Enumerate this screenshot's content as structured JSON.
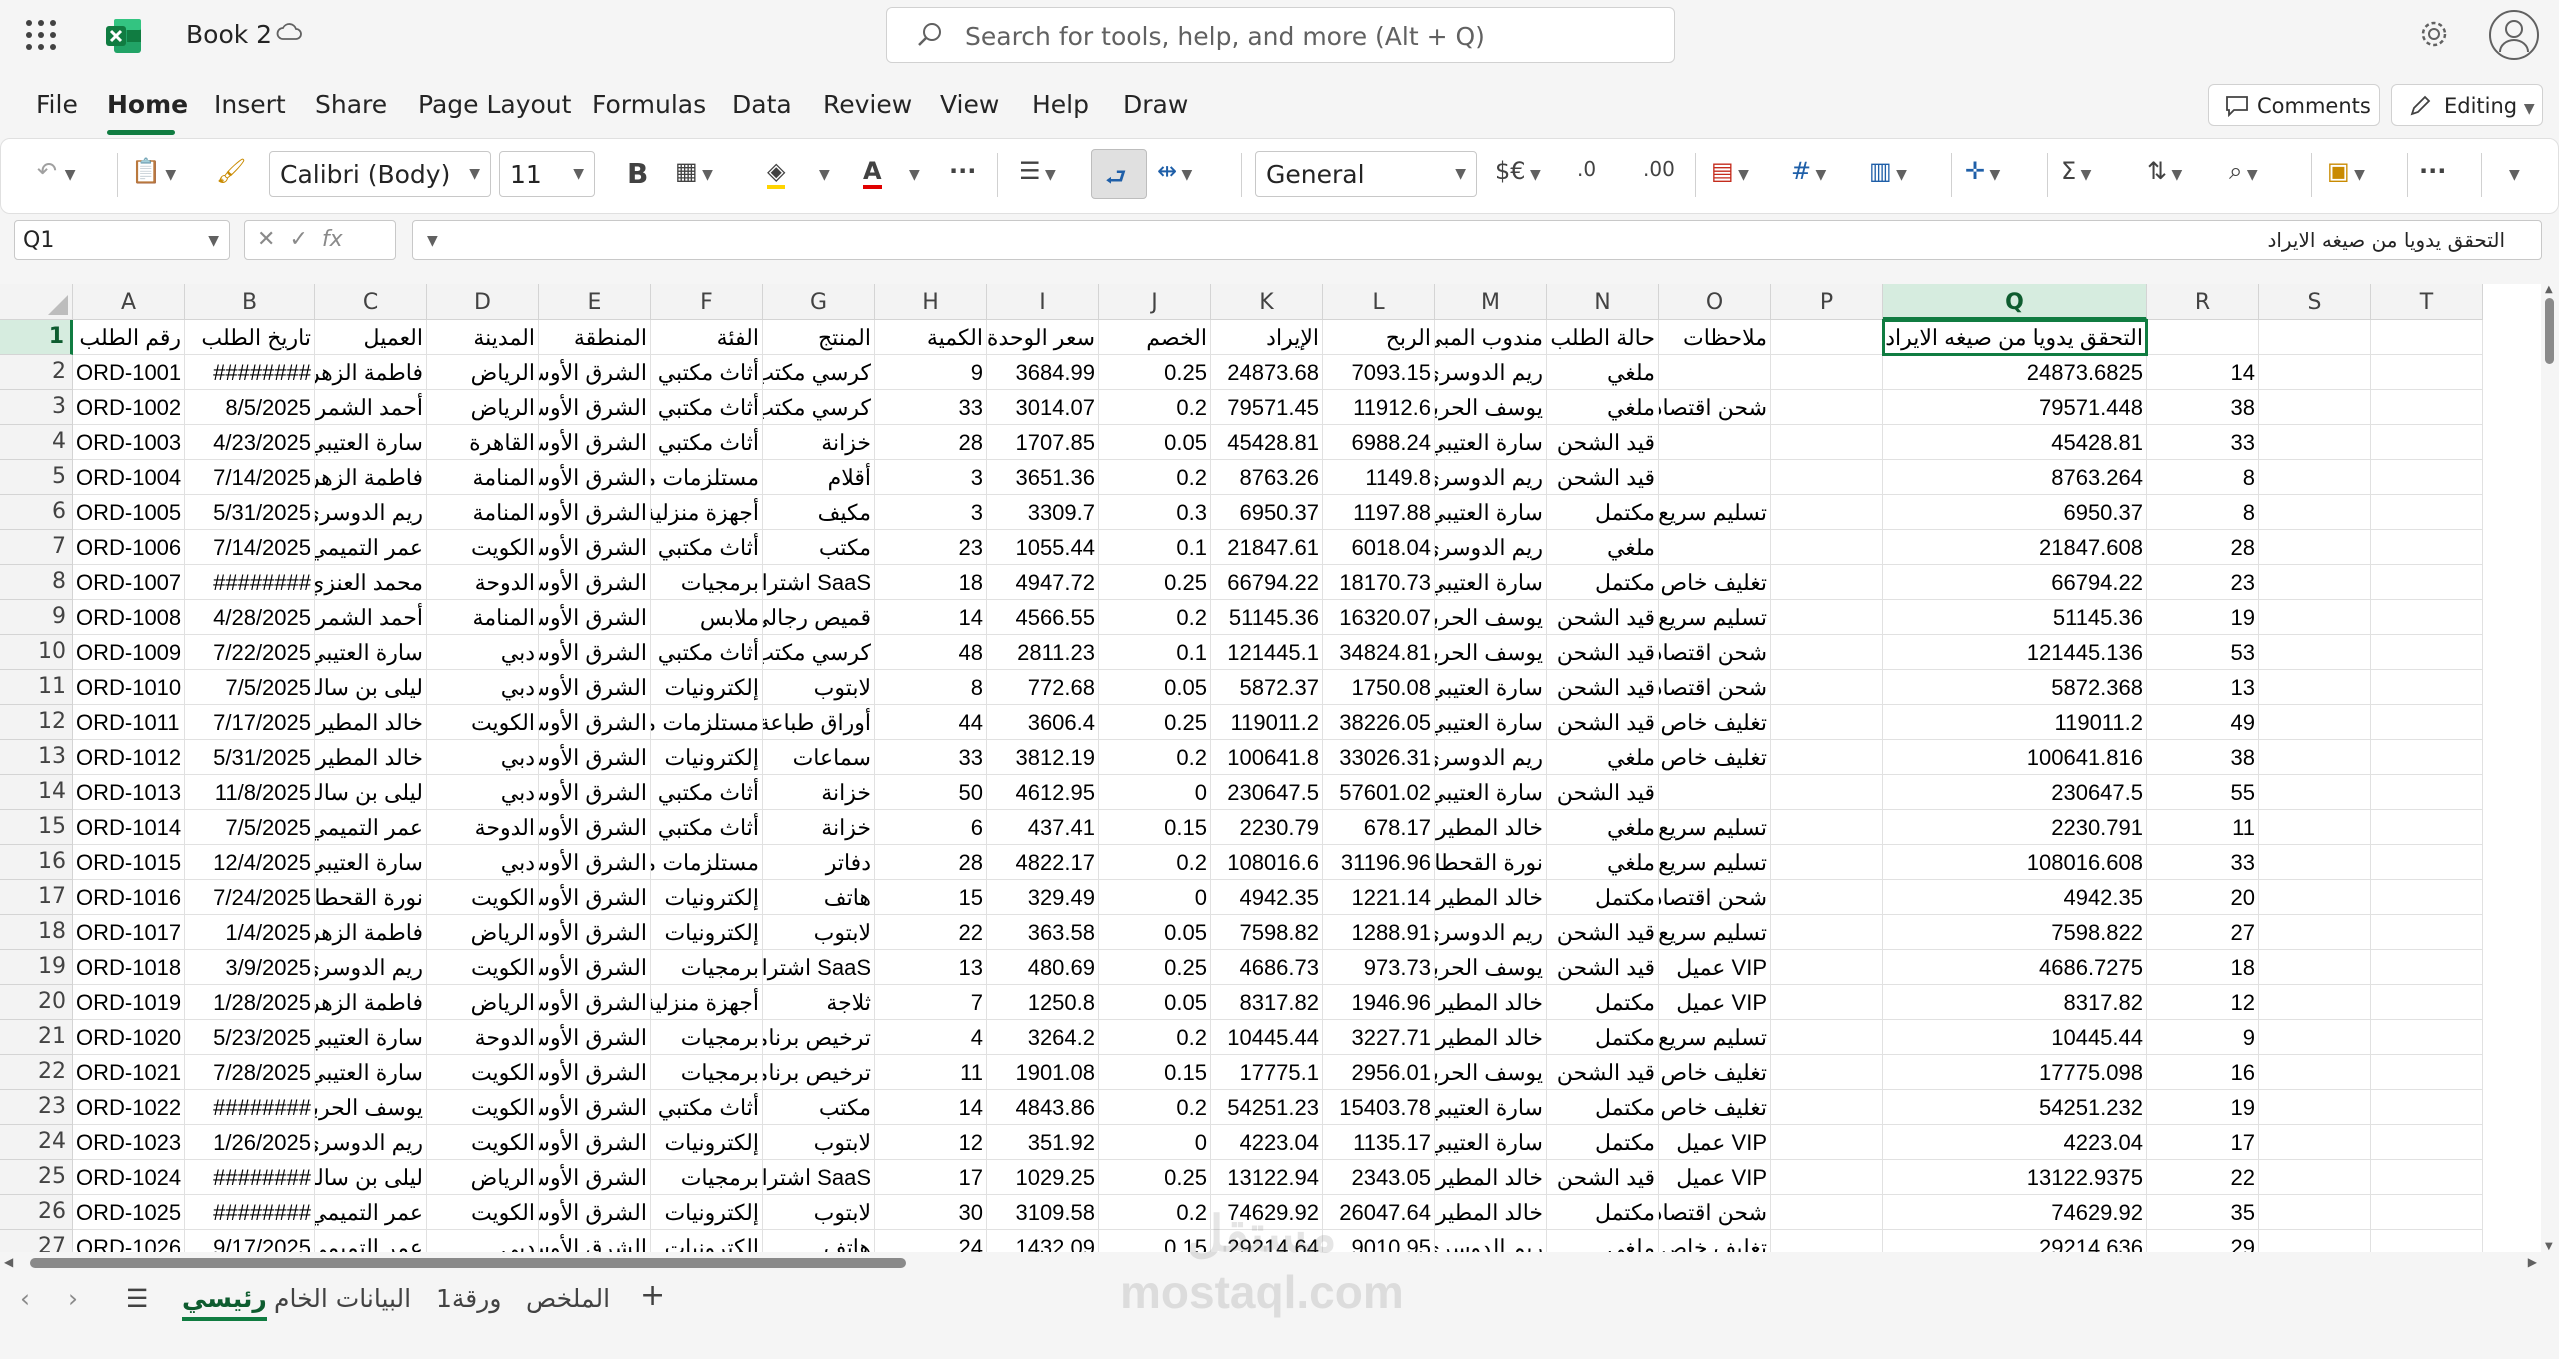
{
  "app": {
    "title": "Book 2",
    "search_placeholder": "Search for tools, help, and more (Alt + Q)"
  },
  "menu": {
    "items": [
      "File",
      "Home",
      "Insert",
      "Share",
      "Page Layout",
      "Formulas",
      "Data",
      "Review",
      "View",
      "Help",
      "Draw"
    ],
    "comments": "Comments",
    "editing": "Editing"
  },
  "ribbon": {
    "font_name": "Calibri (Body)",
    "font_size": "11",
    "number_format": "General",
    "currency": "$€"
  },
  "formula_bar": {
    "name_box": "Q1",
    "fx": "fx",
    "content": "التحقق يدويا من صيغه الايراد"
  },
  "columns": [
    "A",
    "B",
    "C",
    "D",
    "E",
    "F",
    "G",
    "H",
    "I",
    "J",
    "K",
    "L",
    "M",
    "N",
    "O",
    "P",
    "Q",
    "R",
    "S",
    "T"
  ],
  "headers": [
    "رقم الطلب",
    "تاريخ الطلب",
    "العميل",
    "المدينة",
    "المنطقة",
    "الفئة",
    "المنتج",
    "الكمية",
    "سعر الوحدة",
    "الخصم",
    "الإيراد",
    "الربح",
    "مندوب المبي",
    "حالة الطلب",
    "ملاحظات",
    "",
    "التحقق يدويا من صيغه الايراد",
    "",
    "",
    ""
  ],
  "rows": [
    [
      "ORD-1001",
      "########",
      "فاطمة الزهرا",
      "الرياض",
      "الشرق الأوسط",
      "أثاث مكتبي",
      "كرسي مكتب",
      "9",
      "3684.99",
      "0.25",
      "24873.68",
      "7093.15",
      "ريم الدوسري",
      "ملغي",
      "",
      "",
      "24873.6825",
      "14"
    ],
    [
      "ORD-1002",
      "8/5/2025",
      "أحمد الشمري",
      "الرياض",
      "الشرق الأوسط",
      "أثاث مكتبي",
      "كرسي مكتب",
      "33",
      "3014.07",
      "0.2",
      "79571.45",
      "11912.6",
      "يوسف الحربي",
      "ملغي",
      "شحن اقتصادي",
      "",
      "79571.448",
      "38"
    ],
    [
      "ORD-1003",
      "4/23/2025",
      "سارة العتيبي",
      "القاهرة",
      "الشرق الأوسط",
      "أثاث مكتبي",
      "خزانة",
      "28",
      "1707.85",
      "0.05",
      "45428.81",
      "6988.24",
      "سارة العتيبي",
      "قيد الشحن",
      "",
      "",
      "45428.81",
      "33"
    ],
    [
      "ORD-1004",
      "7/14/2025",
      "فاطمة الزهرا",
      "المنامة",
      "الشرق الأوسط",
      "مستلزمات مكتبية",
      "أقلام",
      "3",
      "3651.36",
      "0.2",
      "8763.26",
      "1149.8",
      "ريم الدوسري",
      "قيد الشحن",
      "",
      "",
      "8763.264",
      "8"
    ],
    [
      "ORD-1005",
      "5/31/2025",
      "ريم الدوسري",
      "المنامة",
      "الشرق الأوسط",
      "أجهزة منزلية",
      "مكيف",
      "3",
      "3309.7",
      "0.3",
      "6950.37",
      "1197.88",
      "سارة العتيبي",
      "مكتمل",
      "تسليم سريع",
      "",
      "6950.37",
      "8"
    ],
    [
      "ORD-1006",
      "7/14/2025",
      "عمر التميمي",
      "الكويت",
      "الشرق الأوسط",
      "أثاث مكتبي",
      "مكتب",
      "23",
      "1055.44",
      "0.1",
      "21847.61",
      "6018.04",
      "ريم الدوسري",
      "ملغي",
      "",
      "",
      "21847.608",
      "28"
    ],
    [
      "ORD-1007",
      "########",
      "محمد العنزي",
      "الدوحة",
      "الشرق الأوسط",
      "برمجيات",
      "SaaS اشتراك",
      "18",
      "4947.72",
      "0.25",
      "66794.22",
      "18170.73",
      "سارة العتيبي",
      "مكتمل",
      "تغليف خاص",
      "",
      "66794.22",
      "23"
    ],
    [
      "ORD-1008",
      "4/28/2025",
      "أحمد الشمري",
      "المنامة",
      "الشرق الأوسط",
      "ملابس",
      "قميص رجالي",
      "14",
      "4566.55",
      "0.2",
      "51145.36",
      "16320.07",
      "يوسف الحربي",
      "قيد الشحن",
      "تسليم سريع",
      "",
      "51145.36",
      "19"
    ],
    [
      "ORD-1009",
      "7/22/2025",
      "سارة العتيبي",
      "دبي",
      "الشرق الأوسط",
      "أثاث مكتبي",
      "كرسي مكتب",
      "48",
      "2811.23",
      "0.1",
      "121445.1",
      "34824.81",
      "يوسف الحربي",
      "قيد الشحن",
      "شحن اقتصادي",
      "",
      "121445.136",
      "53"
    ],
    [
      "ORD-1010",
      "7/5/2025",
      "ليلى بن سالم",
      "دبي",
      "الشرق الأوسط",
      "إلكترونيات",
      "لابتوب",
      "8",
      "772.68",
      "0.05",
      "5872.37",
      "1750.08",
      "سارة العتيبي",
      "قيد الشحن",
      "شحن اقتصادي",
      "",
      "5872.368",
      "13"
    ],
    [
      "ORD-1011",
      "7/17/2025",
      "خالد المطيري",
      "الكويت",
      "الشرق الأوسط",
      "مستلزمات مكتبية",
      "أوراق طباعة",
      "44",
      "3606.4",
      "0.25",
      "119011.2",
      "38226.05",
      "سارة العتيبي",
      "قيد الشحن",
      "تغليف خاص",
      "",
      "119011.2",
      "49"
    ],
    [
      "ORD-1012",
      "5/31/2025",
      "خالد المطيري",
      "دبي",
      "الشرق الأوسط",
      "إلكترونيات",
      "سماعات",
      "33",
      "3812.19",
      "0.2",
      "100641.8",
      "33026.31",
      "ريم الدوسري",
      "ملغي",
      "تغليف خاص",
      "",
      "100641.816",
      "38"
    ],
    [
      "ORD-1013",
      "11/8/2025",
      "ليلى بن سالم",
      "دبي",
      "الشرق الأوسط",
      "أثاث مكتبي",
      "خزانة",
      "50",
      "4612.95",
      "0",
      "230647.5",
      "57601.02",
      "سارة العتيبي",
      "قيد الشحن",
      "",
      "",
      "230647.5",
      "55"
    ],
    [
      "ORD-1014",
      "7/5/2025",
      "عمر التميمي",
      "الدوحة",
      "الشرق الأوسط",
      "أثاث مكتبي",
      "خزانة",
      "6",
      "437.41",
      "0.15",
      "2230.79",
      "678.17",
      "خالد المطيري",
      "ملغي",
      "تسليم سريع",
      "",
      "2230.791",
      "11"
    ],
    [
      "ORD-1015",
      "12/4/2025",
      "سارة العتيبي",
      "دبي",
      "الشرق الأوسط",
      "مستلزمات مكتبية",
      "دفاتر",
      "28",
      "4822.17",
      "0.2",
      "108016.6",
      "31196.96",
      "نورة القحطاني",
      "ملغي",
      "تسليم سريع",
      "",
      "108016.608",
      "33"
    ],
    [
      "ORD-1016",
      "7/24/2025",
      "نورة القحطاني",
      "الكويت",
      "الشرق الأوسط",
      "إلكترونيات",
      "هاتف",
      "15",
      "329.49",
      "0",
      "4942.35",
      "1221.14",
      "خالد المطيري",
      "مكتمل",
      "شحن اقتصادي",
      "",
      "4942.35",
      "20"
    ],
    [
      "ORD-1017",
      "1/4/2025",
      "فاطمة الزهرا",
      "الرياض",
      "الشرق الأوسط",
      "إلكترونيات",
      "لابتوب",
      "22",
      "363.58",
      "0.05",
      "7598.82",
      "1288.91",
      "ريم الدوسري",
      "قيد الشحن",
      "تسليم سريع",
      "",
      "7598.822",
      "27"
    ],
    [
      "ORD-1018",
      "3/9/2025",
      "ريم الدوسري",
      "الكويت",
      "الشرق الأوسط",
      "برمجيات",
      "SaaS اشتراك",
      "13",
      "480.69",
      "0.25",
      "4686.73",
      "973.73",
      "يوسف الحربي",
      "قيد الشحن",
      "VIP عميل",
      "",
      "4686.7275",
      "18"
    ],
    [
      "ORD-1019",
      "1/28/2025",
      "فاطمة الزهرا",
      "الرياض",
      "الشرق الأوسط",
      "أجهزة منزلية",
      "ثلاجة",
      "7",
      "1250.8",
      "0.05",
      "8317.82",
      "1946.96",
      "خالد المطيري",
      "مكتمل",
      "VIP عميل",
      "",
      "8317.82",
      "12"
    ],
    [
      "ORD-1020",
      "5/23/2025",
      "سارة العتيبي",
      "الدوحة",
      "الشرق الأوسط",
      "برمجيات",
      "ترخيص برنامج",
      "4",
      "3264.2",
      "0.2",
      "10445.44",
      "3227.71",
      "خالد المطيري",
      "مكتمل",
      "تسليم سريع",
      "",
      "10445.44",
      "9"
    ],
    [
      "ORD-1021",
      "7/28/2025",
      "سارة العتيبي",
      "الكويت",
      "الشرق الأوسط",
      "برمجيات",
      "ترخيص برنامج",
      "11",
      "1901.08",
      "0.15",
      "17775.1",
      "2956.01",
      "يوسف الحربي",
      "قيد الشحن",
      "تغليف خاص",
      "",
      "17775.098",
      "16"
    ],
    [
      "ORD-1022",
      "########",
      "يوسف الحربي",
      "الكويت",
      "الشرق الأوسط",
      "أثاث مكتبي",
      "مكتب",
      "14",
      "4843.86",
      "0.2",
      "54251.23",
      "15403.78",
      "سارة العتيبي",
      "مكتمل",
      "تغليف خاص",
      "",
      "54251.232",
      "19"
    ],
    [
      "ORD-1023",
      "1/26/2025",
      "ريم الدوسري",
      "الكويت",
      "الشرق الأوسط",
      "إلكترونيات",
      "لابتوب",
      "12",
      "351.92",
      "0",
      "4223.04",
      "1135.17",
      "سارة العتيبي",
      "مكتمل",
      "VIP عميل",
      "",
      "4223.04",
      "17"
    ],
    [
      "ORD-1024",
      "########",
      "ليلى بن سالم",
      "الرياض",
      "الشرق الأوسط",
      "برمجيات",
      "SaaS اشتراك",
      "17",
      "1029.25",
      "0.25",
      "13122.94",
      "2343.05",
      "خالد المطيري",
      "قيد الشحن",
      "VIP عميل",
      "",
      "13122.9375",
      "22"
    ],
    [
      "ORD-1025",
      "########",
      "عمر التميمي",
      "الكويت",
      "الشرق الأوسط",
      "إلكترونيات",
      "لابتوب",
      "30",
      "3109.58",
      "0.2",
      "74629.92",
      "26047.64",
      "خالد المطيري",
      "مكتمل",
      "شحن اقتصادي",
      "",
      "74629.92",
      "35"
    ],
    [
      "ORD-1026",
      "9/17/2025",
      "عمر التميمي",
      "دبي",
      "الشرق الأوسط",
      "إلكترونيات",
      "هاتف",
      "24",
      "1432.09",
      "0.15",
      "29214.64",
      "9010.95",
      "ريم الدوسري",
      "ملغي",
      "تغليف خاص",
      "",
      "29214.636",
      "29"
    ]
  ],
  "sheets": [
    "رئيسي",
    "البيانات الخام",
    "ورقة1",
    "الملخص"
  ],
  "watermark": {
    "line1": "مستقل",
    "line2": "mostaql.com"
  },
  "colors": {
    "accent": "#107c41",
    "selected_header_bg": "#d6ecdf"
  }
}
